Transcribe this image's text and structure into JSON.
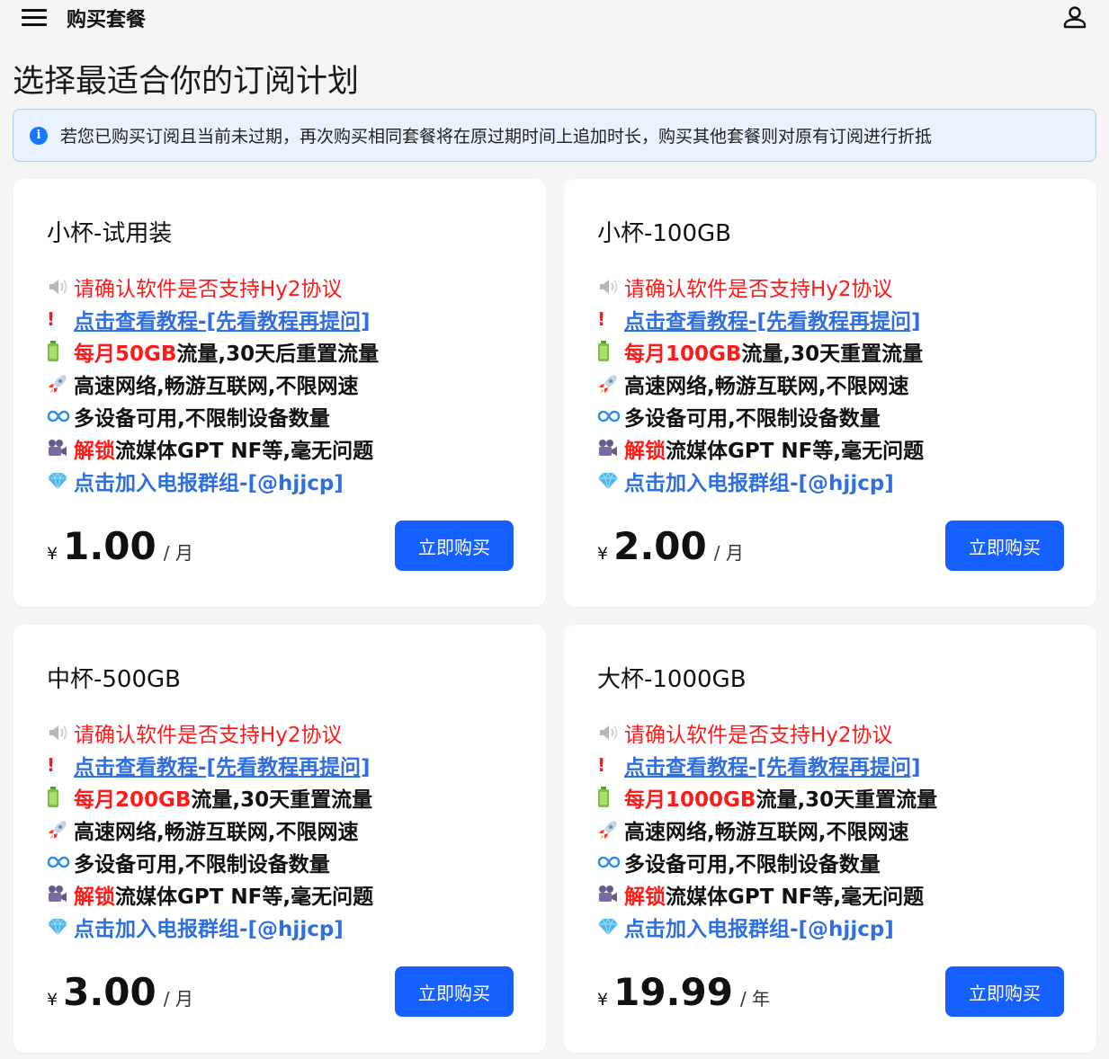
{
  "header": {
    "title": "购买套餐",
    "menu_icon": "menu-icon",
    "user_icon": "user-icon"
  },
  "page_title": "选择最适合你的订阅计划",
  "alert": {
    "icon": "info-icon",
    "text": "若您已购买订阅且当前未过期，再次购买相同套餐将在原过期时间上追加时长，购买其他套餐则对原有订阅进行折抵"
  },
  "colors": {
    "primary": "#1660ff",
    "warning_red": "#ff1a1a",
    "link_blue": "#2f6fe0",
    "alert_bg": "#e9f3ff"
  },
  "plans": [
    {
      "name": "小杯-试用装",
      "features": {
        "protocol": "请确认软件是否支持Hy2协议",
        "tutorial": "点击查看教程-[先看教程再提问]",
        "traffic_highlight": "每月50GB",
        "traffic_rest": "流量,30天后重置流量",
        "speed": "高速网络,畅游互联网,不限网速",
        "devices": "多设备可用,不限制设备数量",
        "unlock_highlight": "解锁",
        "unlock_rest": "流媒体GPT NF等,毫无问题",
        "telegram": "点击加入电报群组-[@hjjcp]"
      },
      "currency": "¥",
      "price": "1.00",
      "period": "/ 月",
      "buy_label": "立即购买"
    },
    {
      "name": "小杯-100GB",
      "features": {
        "protocol": "请确认软件是否支持Hy2协议",
        "tutorial": "点击查看教程-[先看教程再提问]",
        "traffic_highlight": "每月100GB",
        "traffic_rest": "流量,30天重置流量",
        "speed": "高速网络,畅游互联网,不限网速",
        "devices": "多设备可用,不限制设备数量",
        "unlock_highlight": "解锁",
        "unlock_rest": "流媒体GPT NF等,毫无问题",
        "telegram": "点击加入电报群组-[@hjjcp]"
      },
      "currency": "¥",
      "price": "2.00",
      "period": "/ 月",
      "buy_label": "立即购买"
    },
    {
      "name": "中杯-500GB",
      "features": {
        "protocol": "请确认软件是否支持Hy2协议",
        "tutorial": "点击查看教程-[先看教程再提问]",
        "traffic_highlight": "每月200GB",
        "traffic_rest": "流量,30天重置流量",
        "speed": "高速网络,畅游互联网,不限网速",
        "devices": "多设备可用,不限制设备数量",
        "unlock_highlight": "解锁",
        "unlock_rest": "流媒体GPT NF等,毫无问题",
        "telegram": "点击加入电报群组-[@hjjcp]"
      },
      "currency": "¥",
      "price": "3.00",
      "period": "/ 月",
      "buy_label": "立即购买"
    },
    {
      "name": "大杯-1000GB",
      "features": {
        "protocol": "请确认软件是否支持Hy2协议",
        "tutorial": "点击查看教程-[先看教程再提问]",
        "traffic_highlight": "每月1000GB",
        "traffic_rest": "流量,30天重置流量",
        "speed": "高速网络,畅游互联网,不限网速",
        "devices": "多设备可用,不限制设备数量",
        "unlock_highlight": "解锁",
        "unlock_rest": "流媒体GPT NF等,毫无问题",
        "telegram": "点击加入电报群组-[@hjjcp]"
      },
      "currency": "¥",
      "price": "19.99",
      "period": "/ 年",
      "buy_label": "立即购买"
    }
  ]
}
